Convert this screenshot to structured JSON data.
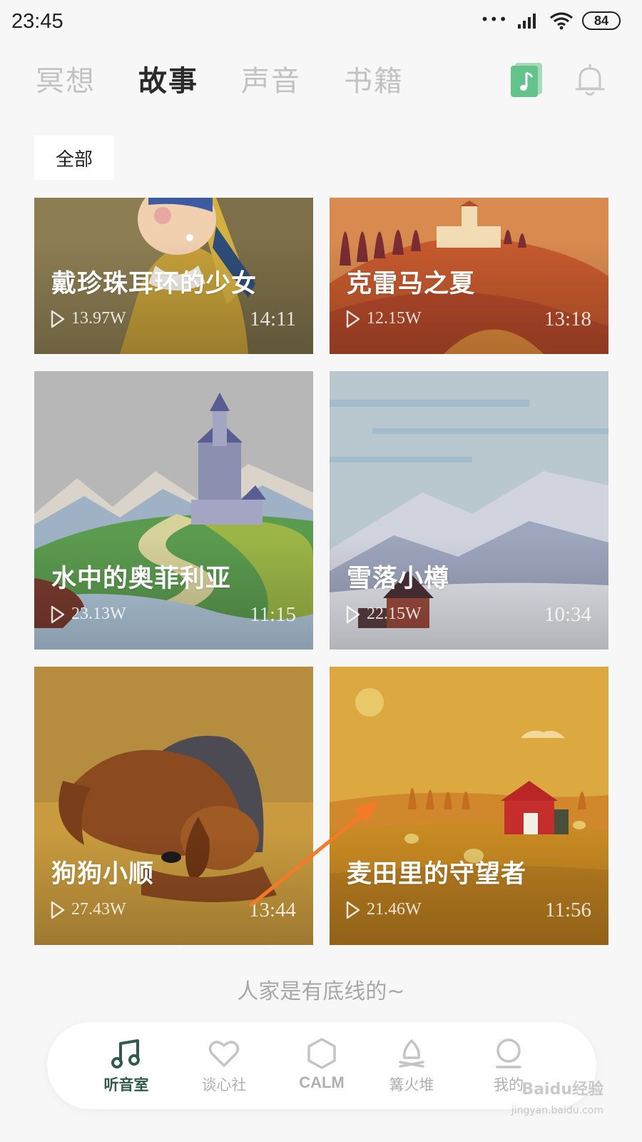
{
  "status_bar": {
    "time": "23:45",
    "battery": "84"
  },
  "top_tabs": [
    {
      "label": "冥想",
      "active": false
    },
    {
      "label": "故事",
      "active": true
    },
    {
      "label": "声音",
      "active": false
    },
    {
      "label": "书籍",
      "active": false
    }
  ],
  "icons": {
    "music": "music-note-icon",
    "bell": "bell-icon",
    "play": "play-icon"
  },
  "filter": {
    "label": "全部"
  },
  "stories": [
    {
      "title": "戴珍珠耳环的少女",
      "plays": "13.97W",
      "duration": "14:11"
    },
    {
      "title": "克雷马之夏",
      "plays": "12.15W",
      "duration": "13:18"
    },
    {
      "title": "水中的奥菲利亚",
      "plays": "23.13W",
      "duration": "11:15"
    },
    {
      "title": "雪落小樽",
      "plays": "22.15W",
      "duration": "10:34"
    },
    {
      "title": "狗狗小顺",
      "plays": "27.43W",
      "duration": "13:44"
    },
    {
      "title": "麦田里的守望者",
      "plays": "21.46W",
      "duration": "11:56"
    }
  ],
  "footer_note": "人家是有底线的~",
  "bottom_nav": [
    {
      "label": "听音室",
      "icon": "music-note-icon",
      "active": true
    },
    {
      "label": "谈心社",
      "icon": "heart-icon",
      "active": false
    },
    {
      "label": "CALM",
      "icon": "hexagon-icon",
      "active": false
    },
    {
      "label": "篝火堆",
      "icon": "campfire-icon",
      "active": false
    },
    {
      "label": "我的",
      "icon": "profile-icon",
      "active": false
    }
  ],
  "watermark": {
    "text": "Baidu经验",
    "sub": "jingyan.baidu.com"
  },
  "colors": {
    "accent": "#2f5a4d",
    "inactive": "#b0b0b0",
    "annotation_arrow": "#f47a2a"
  }
}
